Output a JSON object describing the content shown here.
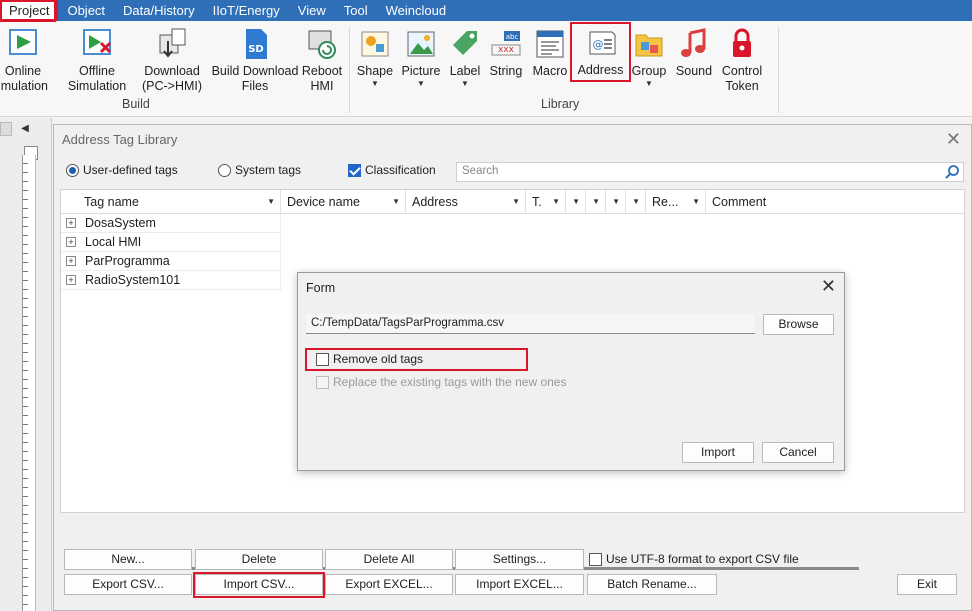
{
  "menubar": {
    "items": [
      "Project",
      "Object",
      "Data/History",
      "IIoT/Energy",
      "View",
      "Tool",
      "Weincloud"
    ]
  },
  "ribbon": {
    "build": {
      "online_sim": [
        "Online",
        "imulation"
      ],
      "offline_sim": [
        "Offline",
        "Simulation"
      ],
      "download": [
        "Download",
        "(PC->HMI)"
      ],
      "build_download": [
        "Build Download",
        "Files"
      ],
      "reboot": [
        "Reboot",
        "HMI"
      ],
      "label": "Build"
    },
    "library": {
      "shape": "Shape",
      "picture": "Picture",
      "label_btn": "Label",
      "string": "String",
      "macro": "Macro",
      "address": "Address",
      "group": "Group",
      "sound": "Sound",
      "control_token": [
        "Control",
        "Token"
      ],
      "label": "Library"
    }
  },
  "dialog": {
    "title": "Address Tag Library",
    "radio_user": "User-defined tags",
    "radio_system": "System tags",
    "classification": "Classification",
    "search_placeholder": "Search",
    "columns": [
      "Tag name",
      "Device name",
      "Address",
      "T.",
      "",
      "",
      "",
      "",
      "Re...",
      "Comment"
    ],
    "tags": [
      "DosaSystem",
      "Local HMI",
      "ParProgramma",
      "RadioSystem101"
    ],
    "buttons": {
      "new": "New...",
      "delete": "Delete",
      "delete_all": "Delete All",
      "settings": "Settings...",
      "utf8": "Use UTF-8 format to export CSV file",
      "export_csv": "Export CSV...",
      "import_csv": "Import CSV...",
      "export_excel": "Export EXCEL...",
      "import_excel": "Import EXCEL...",
      "batch_rename": "Batch Rename...",
      "exit": "Exit"
    }
  },
  "form": {
    "title": "Form",
    "path": "C:/TempData/TagsParProgramma.csv",
    "browse": "Browse",
    "remove_old": "Remove old tags",
    "replace": "Replace the existing tags with the new ones",
    "import": "Import",
    "cancel": "Cancel"
  },
  "colors": {
    "menubar": "#2f6fb8",
    "highlight": "#d9162b"
  }
}
